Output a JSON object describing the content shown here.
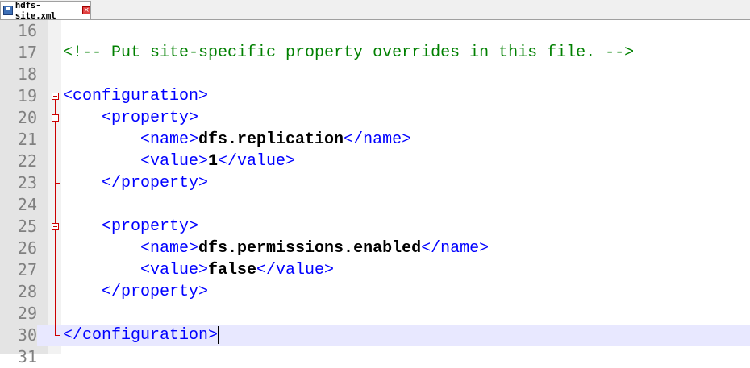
{
  "tab": {
    "label": "hdfs-site.xml",
    "close_glyph": "×"
  },
  "lines": [
    {
      "n": "16",
      "segments": []
    },
    {
      "n": "17",
      "segments": [
        {
          "cls": "cmt",
          "t": "<!-- Put site-specific property overrides in this file. -->"
        }
      ]
    },
    {
      "n": "18",
      "segments": []
    },
    {
      "n": "19",
      "segments": [
        {
          "cls": "tag",
          "t": "<configuration>"
        }
      ]
    },
    {
      "n": "20",
      "segments": [
        {
          "cls": "",
          "t": "    "
        },
        {
          "cls": "tag",
          "t": "<property>"
        }
      ]
    },
    {
      "n": "21",
      "segments": [
        {
          "cls": "",
          "t": "        "
        },
        {
          "cls": "tag",
          "t": "<name>"
        },
        {
          "cls": "txt",
          "t": "dfs.replication"
        },
        {
          "cls": "tag",
          "t": "</name>"
        }
      ]
    },
    {
      "n": "22",
      "segments": [
        {
          "cls": "",
          "t": "        "
        },
        {
          "cls": "tag",
          "t": "<value>"
        },
        {
          "cls": "txt",
          "t": "1"
        },
        {
          "cls": "tag",
          "t": "</value>"
        }
      ]
    },
    {
      "n": "23",
      "segments": [
        {
          "cls": "",
          "t": "    "
        },
        {
          "cls": "tag",
          "t": "</property>"
        }
      ]
    },
    {
      "n": "24",
      "segments": []
    },
    {
      "n": "25",
      "segments": [
        {
          "cls": "",
          "t": "    "
        },
        {
          "cls": "tag",
          "t": "<property>"
        }
      ]
    },
    {
      "n": "26",
      "segments": [
        {
          "cls": "",
          "t": "        "
        },
        {
          "cls": "tag",
          "t": "<name>"
        },
        {
          "cls": "txt",
          "t": "dfs.permissions.enabled"
        },
        {
          "cls": "tag",
          "t": "</name>"
        }
      ]
    },
    {
      "n": "27",
      "segments": [
        {
          "cls": "",
          "t": "        "
        },
        {
          "cls": "tag",
          "t": "<value>"
        },
        {
          "cls": "txt",
          "t": "false"
        },
        {
          "cls": "tag",
          "t": "</value>"
        }
      ]
    },
    {
      "n": "28",
      "segments": [
        {
          "cls": "",
          "t": "    "
        },
        {
          "cls": "tag",
          "t": "</property>"
        }
      ]
    },
    {
      "n": "29",
      "segments": []
    },
    {
      "n": "30",
      "segments": [
        {
          "cls": "tag",
          "t": "</configuration>"
        }
      ],
      "current": true
    },
    {
      "n": "31",
      "segments": []
    }
  ],
  "colors": {
    "comment": "#008000",
    "tag": "#0000ff",
    "text": "#000000",
    "fold": "#cc0000",
    "current_line": "#e8e8ff"
  },
  "icons": {
    "tab_icon": "save-icon",
    "tab_close": "close-icon",
    "fold_toggle": "fold-minus-icon"
  }
}
